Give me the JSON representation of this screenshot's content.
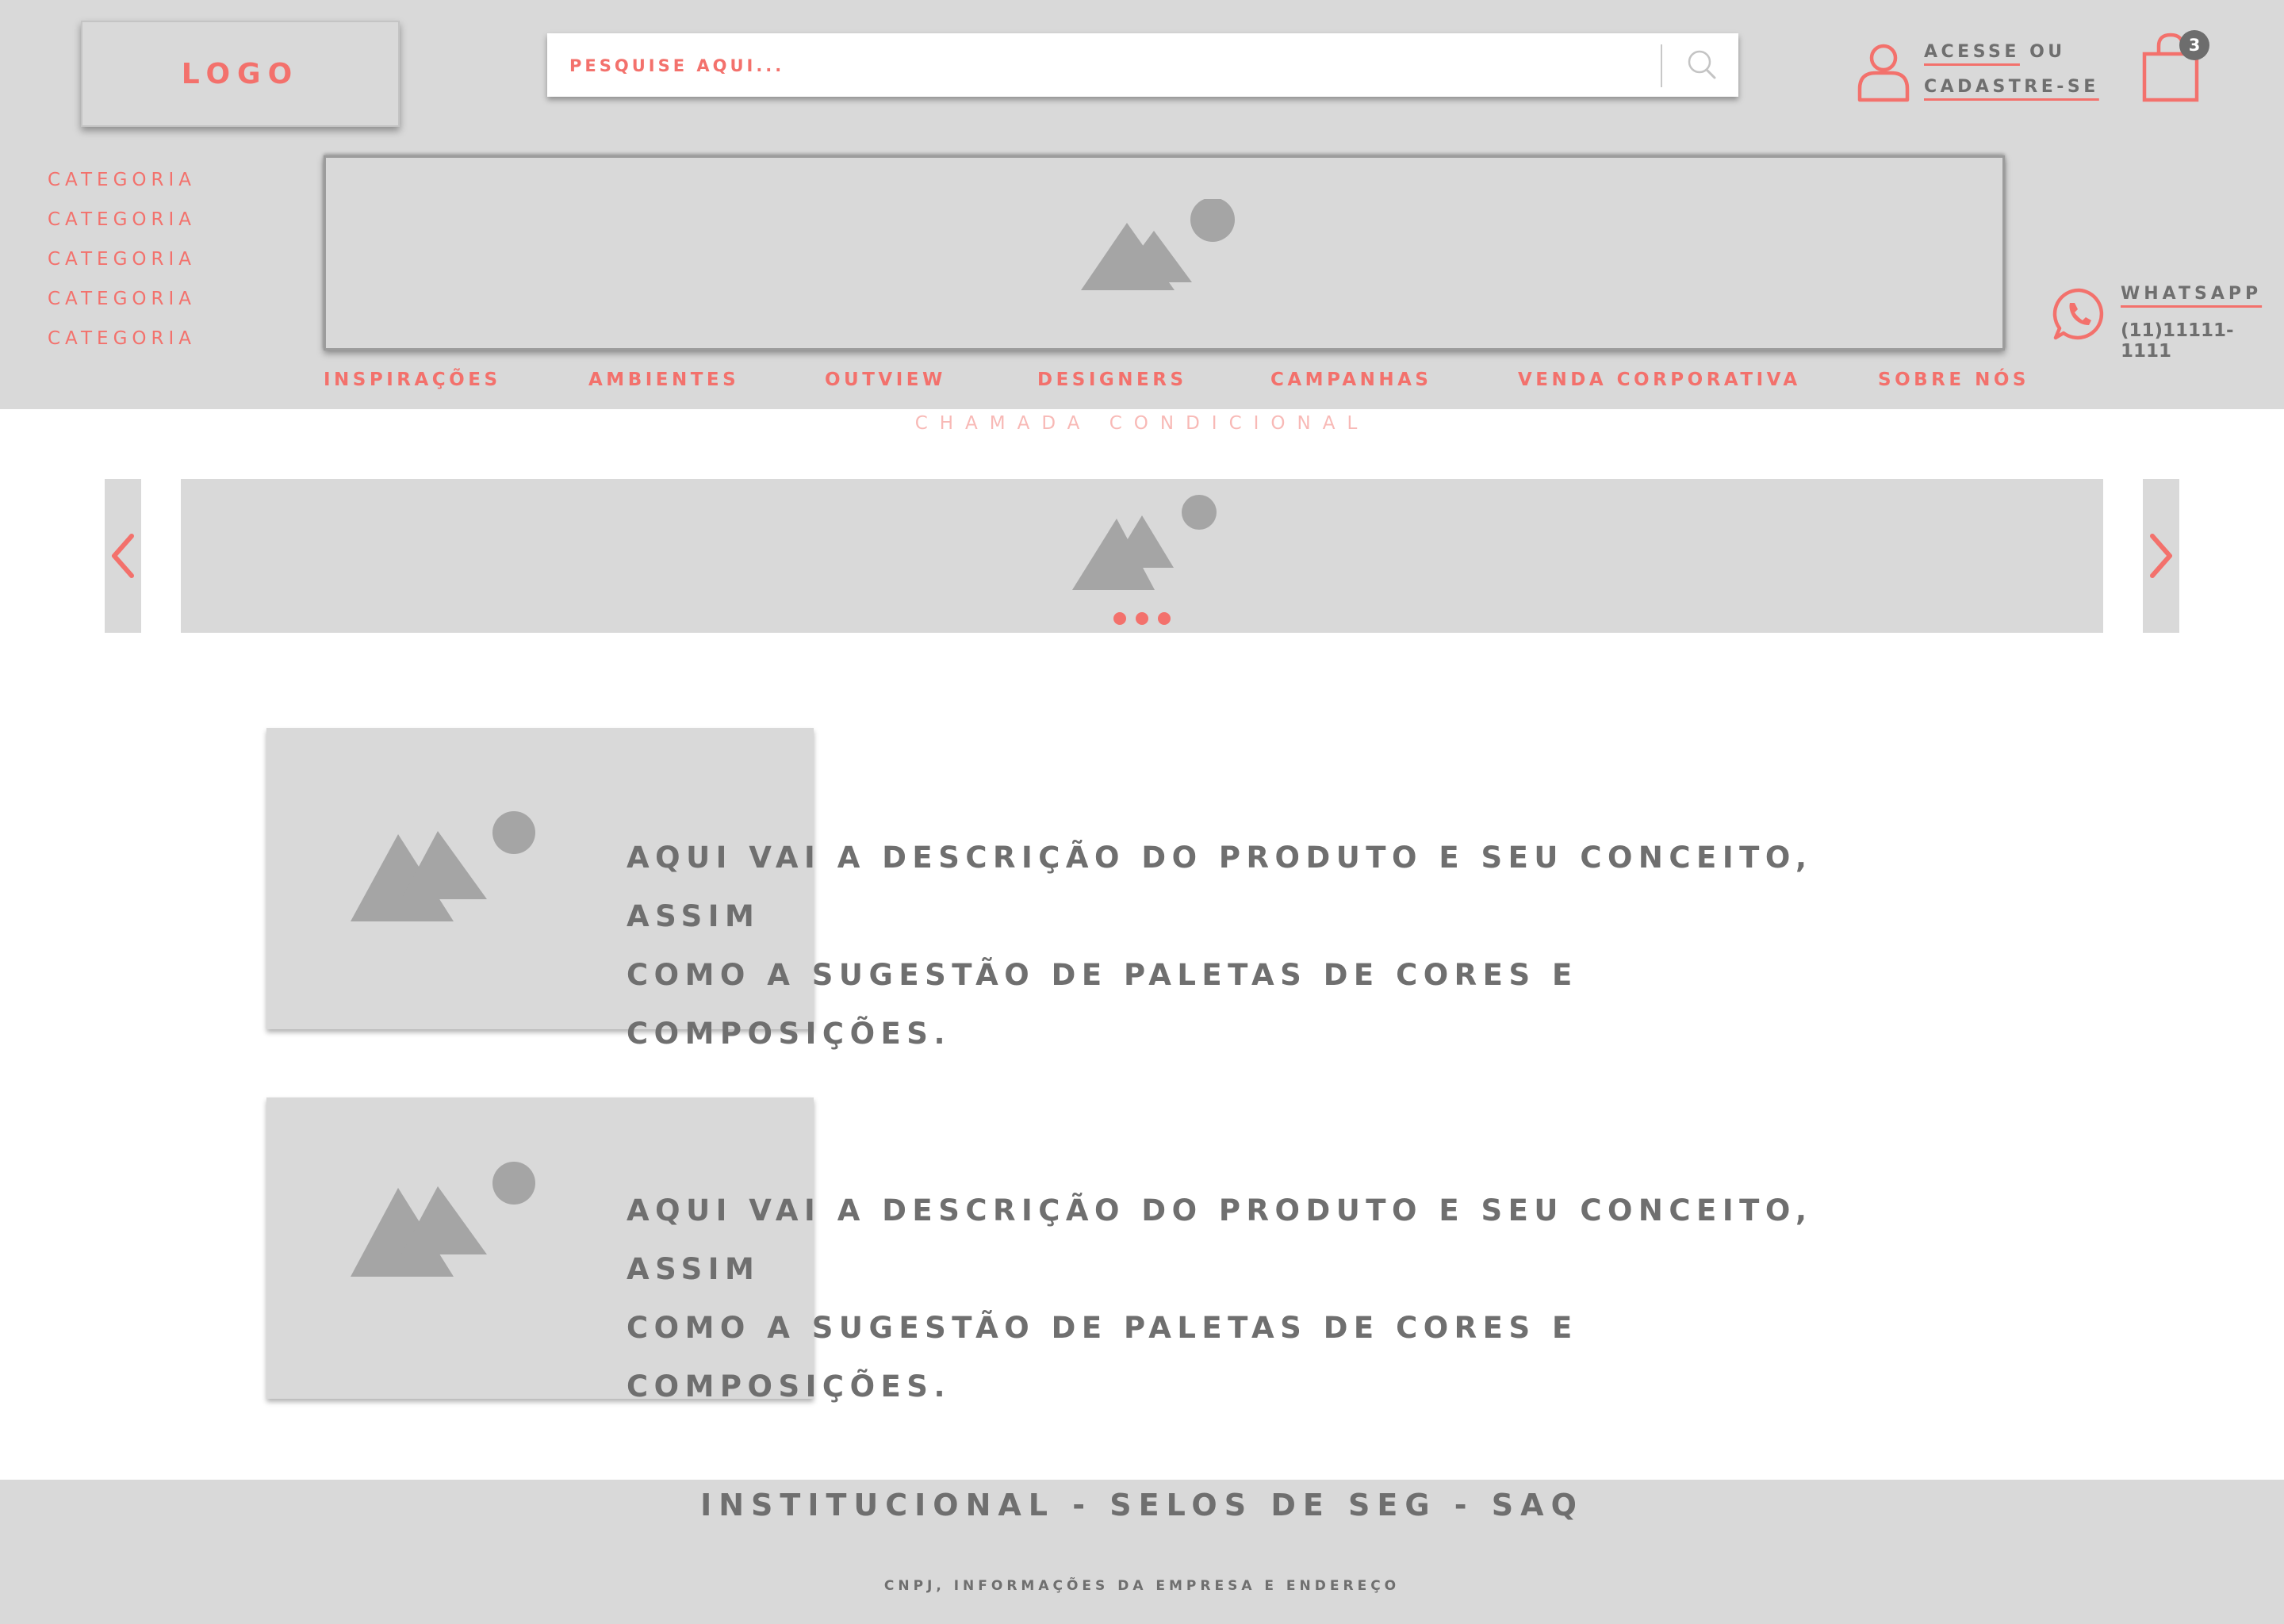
{
  "header": {
    "logo": "LOGO",
    "search": {
      "placeholder": "PESQUISE AQUI..."
    },
    "account": {
      "access": "ACESSE",
      "or": "OU",
      "register": "CADASTRE-SE"
    },
    "cart": {
      "count": "3"
    }
  },
  "categories": [
    "CATEGORIA",
    "CATEGORIA",
    "CATEGORIA",
    "CATEGORIA",
    "CATEGORIA"
  ],
  "contact": {
    "label": "WHATSAPP",
    "phone": "(11)11111-1111"
  },
  "nav": [
    "INSPIRAÇÕES",
    "AMBIENTES",
    "OUTVIEW",
    "DESIGNERS",
    "CAMPANHAS",
    "VENDA CORPORATIVA",
    "SOBRE NÓS"
  ],
  "promo": "CHAMADA CONDICIONAL",
  "carousel": {
    "slide_count": 3
  },
  "products": [
    {
      "line1": "AQUI VAI A DESCRIÇÃO DO PRODUTO E SEU CONCEITO, ASSIM",
      "line2": "COMO A SUGESTÃO DE PALETAS DE CORES E COMPOSIÇÕES."
    },
    {
      "line1": "AQUI VAI A DESCRIÇÃO DO PRODUTO E SEU CONCEITO, ASSIM",
      "line2": "COMO A SUGESTÃO DE PALETAS DE CORES E COMPOSIÇÕES."
    }
  ],
  "footer": {
    "title": "INSTITUCIONAL - SELOS DE SEG - SAQ",
    "info": "CNPJ, INFORMAÇÕES DA EMPRESA E ENDEREÇO"
  },
  "colors": {
    "accent": "#f3716c",
    "placeholder_bg": "#d9d9d9",
    "text": "#6f6f6f",
    "icon_grey": "#a5a5a5"
  }
}
